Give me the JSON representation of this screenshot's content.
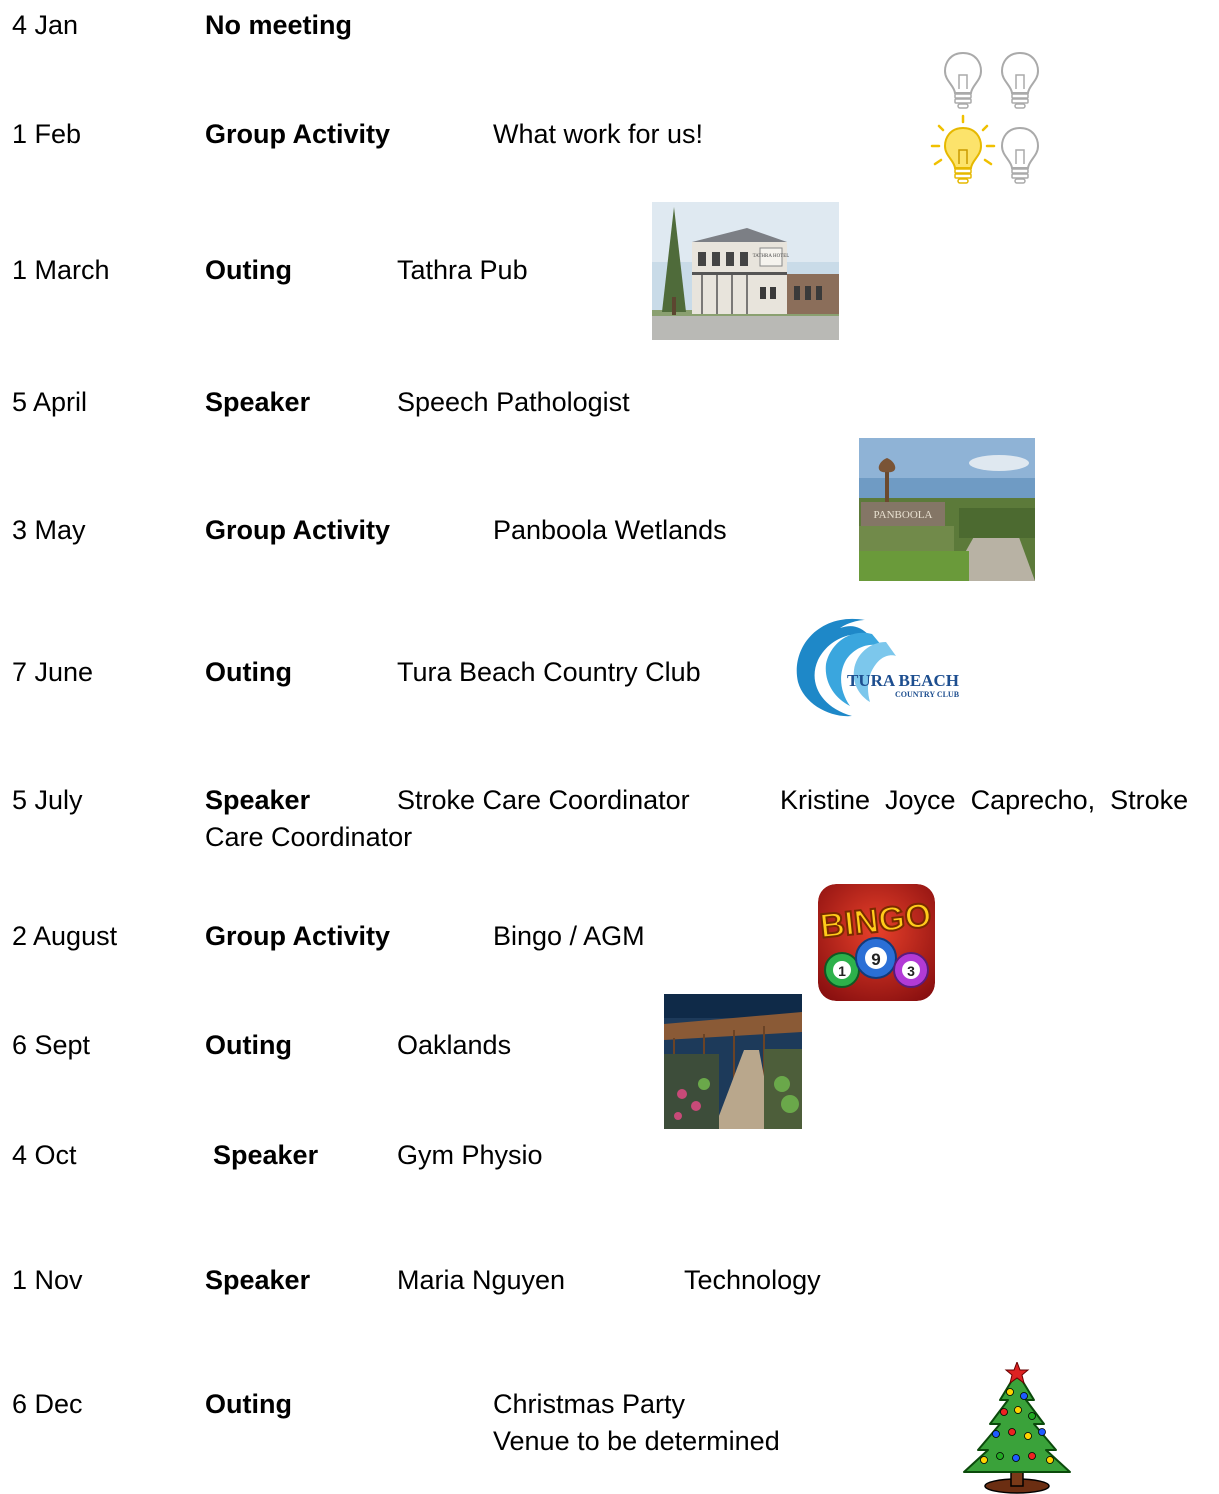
{
  "events": [
    {
      "date": "4 Jan",
      "type": "No meeting"
    },
    {
      "date": "1 Feb",
      "type": "Group Activity",
      "detail": "What work for us!"
    },
    {
      "date": "1 March",
      "type": "Outing",
      "detail": "Tathra Pub"
    },
    {
      "date": "5 April",
      "type": "Speaker",
      "detail": "Speech Pathologist"
    },
    {
      "date": "3 May",
      "type": "Group Activity",
      "detail": "Panboola Wetlands"
    },
    {
      "date": "7 June",
      "type": "Outing",
      "detail": "Tura Beach Country Club"
    },
    {
      "date": "5 July",
      "type": "Speaker",
      "detail": "Stroke Care Coordinator",
      "extra": "Kristine  Joyce  Caprecho,  Stroke",
      "extra2": "Care Coordinator"
    },
    {
      "date": "2 August",
      "type": "Group Activity",
      "detail": "Bingo / AGM"
    },
    {
      "date": "6 Sept",
      "type": "Outing",
      "detail": "Oaklands"
    },
    {
      "date": "4 Oct",
      "type": "Speaker",
      "detail": "Gym Physio"
    },
    {
      "date": "1 Nov",
      "type": "Speaker",
      "detail": "Maria Nguyen",
      "extra": "Technology"
    },
    {
      "date": "6 Dec",
      "type": "Outing",
      "detail": "Christmas Party",
      "extra": "Venue to be determined"
    }
  ],
  "images": {
    "tathra_sign": "TATHRA HOTEL",
    "panboola_sign": "PANBOOLA",
    "tura_logo_1": "TURA BEACH",
    "tura_logo_2": "COUNTRY CLUB",
    "bingo_title": "BINGO",
    "bingo_balls": [
      "1",
      "9",
      "3"
    ]
  }
}
